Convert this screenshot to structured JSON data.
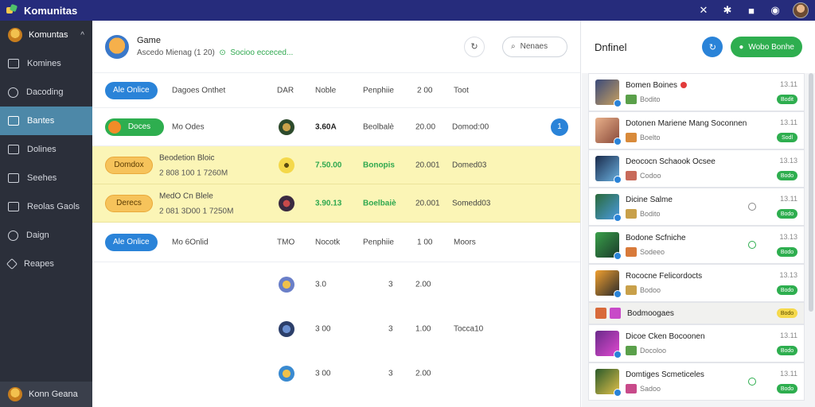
{
  "app": {
    "name": "Komunitas"
  },
  "sidebar": {
    "header": "Komuntas",
    "items": [
      {
        "label": "Komines",
        "icon": "community-icon"
      },
      {
        "label": "Dacoding",
        "icon": "compass-icon"
      },
      {
        "label": "Bantes",
        "icon": "list-icon",
        "active": true
      },
      {
        "label": "Dolines",
        "icon": "doc-icon"
      },
      {
        "label": "Seehes",
        "icon": "square-icon"
      },
      {
        "label": "Reolas Gaols",
        "icon": "edit-icon"
      },
      {
        "label": "Daign",
        "icon": "help-icon"
      },
      {
        "label": "Reapes",
        "icon": "shape-icon"
      }
    ],
    "footer": "Konn Geana"
  },
  "main": {
    "header": {
      "title": "Game",
      "subtitle": "Ascedo Mienag (1 20)",
      "status": "Socioo ecceced..."
    },
    "search_label": "Nenaes",
    "table1": {
      "tab": "Ale Onlice",
      "label": "Dagoes Onthet",
      "cols": [
        "DAR",
        "Noble",
        "Penphiie",
        "2 00",
        "Toot"
      ]
    },
    "rows": [
      {
        "badge": "Doces",
        "name": "Mo Odes",
        "sub": "",
        "price": "3.60A",
        "cat": "Beolbalè",
        "n": "20.00",
        "tag": "Domod:00",
        "count": "1"
      },
      {
        "badge": "Domdox",
        "name": "Beodetion Bloic",
        "sub": "2 808 100 1 7260M",
        "price": "7.50.00",
        "cat": "Bonopis",
        "n": "20.001",
        "tag": "Domed03"
      },
      {
        "badge": "Derecs",
        "name": "MedO Cn Blele",
        "sub": "2 081 3D00 1 7250M",
        "price": "3.90.13",
        "cat": "Boelbaiè",
        "n": "20.001",
        "tag": "Somedd03"
      }
    ],
    "table2": {
      "tab": "Ale Onlice",
      "label": "Mo 6Onlid",
      "cols": [
        "TMO",
        "Nocotk",
        "Penphiie",
        "1 00",
        "Moors"
      ]
    },
    "rows2": [
      {
        "a": "3.0",
        "b": "3",
        "c": "2.00",
        "d": ""
      },
      {
        "a": "3 00",
        "b": "3",
        "c": "1.00",
        "d": "Tocca10"
      },
      {
        "a": "3 00",
        "b": "3",
        "c": "2.00",
        "d": ""
      }
    ]
  },
  "right": {
    "title": "Dnfinel",
    "cta": "Wobo Bonhe",
    "cards": [
      {
        "title": "Bomen Boines",
        "sub": "Bodito",
        "meta": "13.11",
        "tag": "Bodit",
        "red": true
      },
      {
        "title": "Dotonen Mariene Mang Soconnen",
        "sub": "Boelto",
        "meta": "13.11",
        "tag": "Sodl"
      },
      {
        "title": "Deococn Schaook Ocsee",
        "sub": "Codoo",
        "meta": "13.13",
        "tag": "Bodo"
      },
      {
        "title": "Dicine Salme",
        "sub": "Bodito",
        "meta": "13.11",
        "tag": "Bodo"
      },
      {
        "title": "Bodone Scfniche",
        "sub": "Sodeeo",
        "meta": "13.13",
        "tag": "Bodo"
      },
      {
        "title": "Rococne Felicordocts",
        "sub": "Bodoo",
        "meta": "13.13",
        "tag": "Bodo"
      },
      {
        "title": "Bodmoogaes",
        "sub": "",
        "meta": "",
        "tag": "Bodo"
      },
      {
        "title": "Dicoe Cken Bocoonen",
        "sub": "Docoloo",
        "meta": "13.11",
        "tag": "Bodo"
      },
      {
        "title": "Domtiges Scmeticeles",
        "sub": "Sadoo",
        "meta": "13.11",
        "tag": "Bodo"
      }
    ]
  },
  "colors": {
    "topbar": "#262c7c",
    "sidebar": "#2b2f3a",
    "accent_blue": "#2a83d8",
    "accent_green": "#2eae4f",
    "highlight": "#fbf5b6"
  }
}
